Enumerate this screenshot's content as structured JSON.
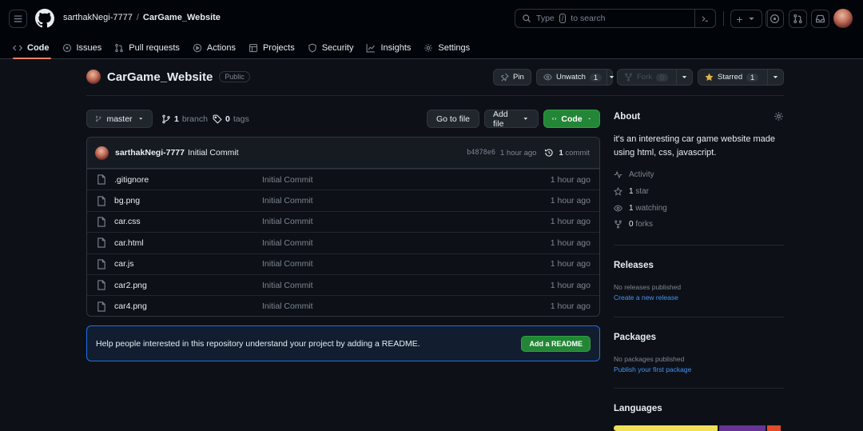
{
  "header": {
    "owner": "sarthakNegi-7777",
    "separator": "/",
    "repo": "CarGame_Website",
    "search_pre": "Type",
    "search_key": "/",
    "search_post": "to search",
    "plus_label": "+"
  },
  "nav": {
    "tabs": [
      {
        "label": "Code",
        "icon": "code-icon"
      },
      {
        "label": "Issues",
        "icon": "issue-icon"
      },
      {
        "label": "Pull requests",
        "icon": "pull-request-icon"
      },
      {
        "label": "Actions",
        "icon": "play-icon"
      },
      {
        "label": "Projects",
        "icon": "table-icon"
      },
      {
        "label": "Security",
        "icon": "shield-icon"
      },
      {
        "label": "Insights",
        "icon": "graph-icon"
      },
      {
        "label": "Settings",
        "icon": "gear-icon"
      }
    ]
  },
  "repo": {
    "name": "CarGame_Website",
    "visibility": "Public",
    "pin": "Pin",
    "unwatch": "Unwatch",
    "watch_count": "1",
    "fork": "Fork",
    "fork_count": "0",
    "starred": "Starred",
    "star_count": "1"
  },
  "toolbar": {
    "branch": "master",
    "branch_count": "1",
    "branch_label": "branch",
    "tag_count": "0",
    "tag_label": "tags",
    "goto_file": "Go to file",
    "add_file": "Add file",
    "code": "Code"
  },
  "commit": {
    "author": "sarthakNegi-7777",
    "message": "Initial Commit",
    "hash": "b4878e6",
    "time": "1 hour ago",
    "count": "1",
    "count_label": "commit"
  },
  "files": [
    {
      "name": ".gitignore",
      "message": "Initial Commit",
      "time": "1 hour ago"
    },
    {
      "name": "bg.png",
      "message": "Initial Commit",
      "time": "1 hour ago"
    },
    {
      "name": "car.css",
      "message": "Initial Commit",
      "time": "1 hour ago"
    },
    {
      "name": "car.html",
      "message": "Initial Commit",
      "time": "1 hour ago"
    },
    {
      "name": "car.js",
      "message": "Initial Commit",
      "time": "1 hour ago"
    },
    {
      "name": "car2.png",
      "message": "Initial Commit",
      "time": "1 hour ago"
    },
    {
      "name": "car4.png",
      "message": "Initial Commit",
      "time": "1 hour ago"
    }
  ],
  "readme": {
    "text": "Help people interested in this repository understand your project by adding a README.",
    "button": "Add a README"
  },
  "about": {
    "title": "About",
    "description": "it's an interesting car game website made using html, css, javascript.",
    "activity": "Activity",
    "stars_count": "1",
    "stars_label": "star",
    "watching_count": "1",
    "watching_label": "watching",
    "forks_count": "0",
    "forks_label": "forks"
  },
  "releases": {
    "title": "Releases",
    "empty": "No releases published",
    "link": "Create a new release"
  },
  "packages": {
    "title": "Packages",
    "empty": "No packages published",
    "link": "Publish your first package"
  },
  "languages": {
    "title": "Languages",
    "bars": [
      {
        "color": "#f1e05a",
        "share": 0.62
      },
      {
        "color": "#663399",
        "share": 0.28
      },
      {
        "color": "#e34c26",
        "share": 0.08
      }
    ]
  },
  "colors": {
    "accent_green": "#238636",
    "link_blue": "#4493f8",
    "tab_underline": "#f78166"
  }
}
